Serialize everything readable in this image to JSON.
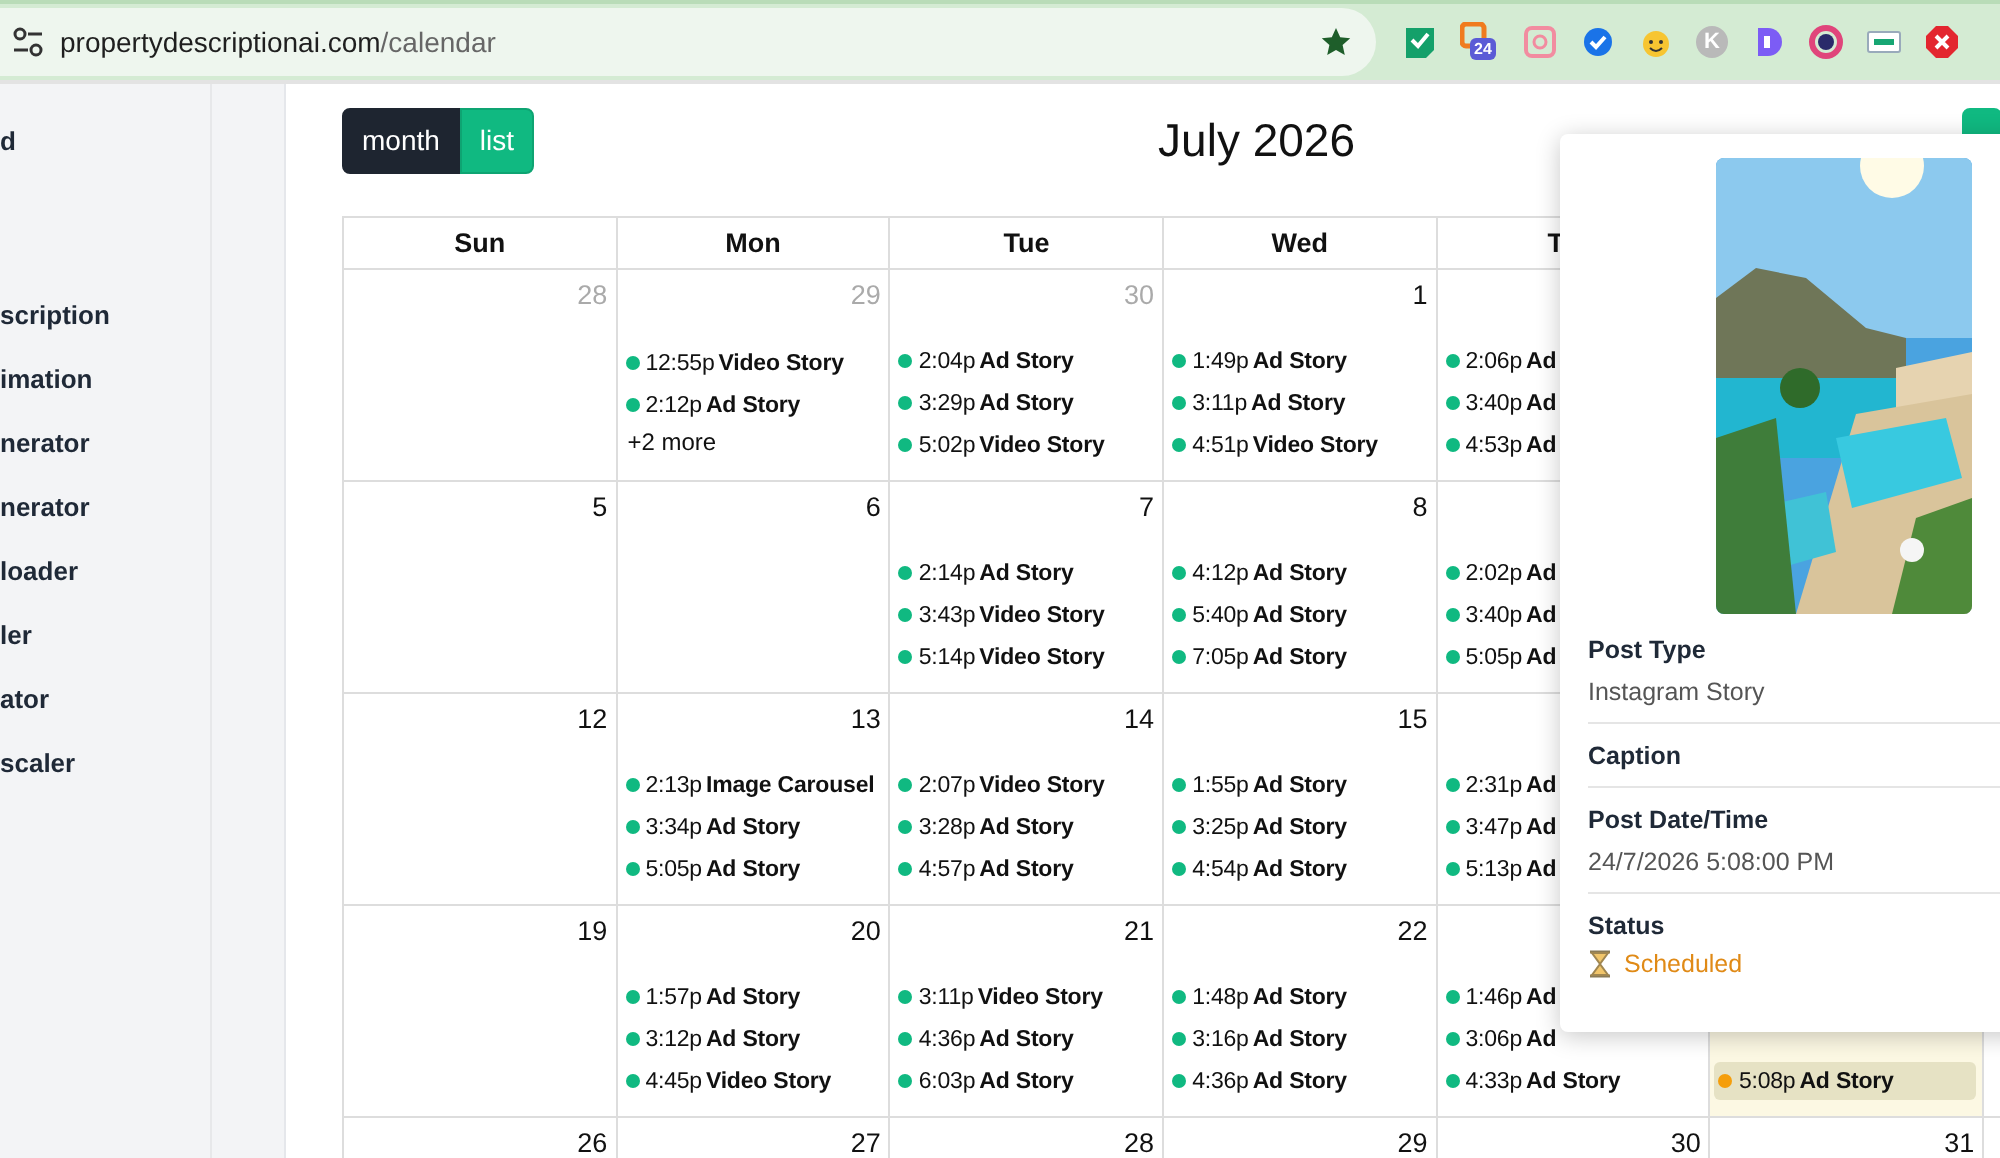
{
  "browser": {
    "url_host": "propertydescriptionai.com",
    "url_path": "/calendar",
    "extensions": [
      {
        "kind": "check"
      },
      {
        "kind": "calendar",
        "badge": "24"
      },
      {
        "kind": "square"
      },
      {
        "kind": "check-circle"
      },
      {
        "kind": "smiley"
      },
      {
        "kind": "letter",
        "letter": "K"
      },
      {
        "kind": "d"
      },
      {
        "kind": "ring"
      },
      {
        "kind": "card"
      },
      {
        "kind": "stop"
      }
    ]
  },
  "sidebar": {
    "items": [
      {
        "label": "d"
      },
      {
        "label": "scription"
      },
      {
        "label": "imation"
      },
      {
        "label": "nerator"
      },
      {
        "label": "nerator"
      },
      {
        "label": "loader"
      },
      {
        "label": "ler"
      },
      {
        "label": "ator"
      },
      {
        "label": "scaler"
      }
    ]
  },
  "toolbar": {
    "views": [
      {
        "label": "month",
        "selected": false
      },
      {
        "label": "list",
        "selected": true
      }
    ],
    "title": "July 2026"
  },
  "calendar": {
    "weekdays": [
      "Sun",
      "Mon",
      "Tue",
      "Wed",
      "T"
    ],
    "weeks": [
      {
        "days": [
          {
            "number": "28",
            "outside": true,
            "today": false
          },
          {
            "number": "29",
            "outside": true,
            "today": false,
            "events": [
              {
                "time": "12:55p",
                "title": "Video Story",
                "color": "#10b981",
                "selected": false
              },
              {
                "time": "2:12p",
                "title": "Ad Story",
                "color": "#10b981",
                "selected": false
              }
            ],
            "more": "+2 more"
          },
          {
            "number": "30",
            "outside": true,
            "today": false,
            "events": [
              {
                "time": "2:04p",
                "title": "Ad Story",
                "color": "#10b981",
                "selected": false
              },
              {
                "time": "3:29p",
                "title": "Ad Story",
                "color": "#10b981",
                "selected": false
              },
              {
                "time": "5:02p",
                "title": "Video Story",
                "color": "#10b981",
                "selected": false
              }
            ]
          },
          {
            "number": "1",
            "outside": false,
            "today": false,
            "events": [
              {
                "time": "1:49p",
                "title": "Ad Story",
                "color": "#10b981",
                "selected": false
              },
              {
                "time": "3:11p",
                "title": "Ad Story",
                "color": "#10b981",
                "selected": false
              },
              {
                "time": "4:51p",
                "title": "Video Story",
                "color": "#10b981",
                "selected": false
              }
            ]
          },
          {
            "today": false,
            "events": [
              {
                "time": "2:06p",
                "title": "Ad",
                "color": "#10b981",
                "selected": false
              },
              {
                "time": "3:40p",
                "title": "Ad",
                "color": "#10b981",
                "selected": false
              },
              {
                "time": "4:53p",
                "title": "Ad",
                "color": "#10b981",
                "selected": false
              }
            ]
          }
        ]
      },
      {
        "days": [
          {
            "number": "5",
            "outside": false,
            "today": false
          },
          {
            "number": "6",
            "outside": false,
            "today": false
          },
          {
            "number": "7",
            "outside": false,
            "today": false,
            "events": [
              {
                "time": "2:14p",
                "title": "Ad Story",
                "color": "#10b981",
                "selected": false
              },
              {
                "time": "3:43p",
                "title": "Video Story",
                "color": "#10b981",
                "selected": false
              },
              {
                "time": "5:14p",
                "title": "Video Story",
                "color": "#10b981",
                "selected": false
              }
            ]
          },
          {
            "number": "8",
            "outside": false,
            "today": false,
            "events": [
              {
                "time": "4:12p",
                "title": "Ad Story",
                "color": "#10b981",
                "selected": false
              },
              {
                "time": "5:40p",
                "title": "Ad Story",
                "color": "#10b981",
                "selected": false
              },
              {
                "time": "7:05p",
                "title": "Ad Story",
                "color": "#10b981",
                "selected": false
              }
            ]
          },
          {
            "today": false,
            "events": [
              {
                "time": "2:02p",
                "title": "Ad",
                "color": "#10b981",
                "selected": false
              },
              {
                "time": "3:40p",
                "title": "Ad",
                "color": "#10b981",
                "selected": false
              },
              {
                "time": "5:05p",
                "title": "Ad",
                "color": "#10b981",
                "selected": false
              }
            ]
          }
        ]
      },
      {
        "days": [
          {
            "number": "12",
            "outside": false,
            "today": false
          },
          {
            "number": "13",
            "outside": false,
            "today": false,
            "events": [
              {
                "time": "2:13p",
                "title": "Image Carousel",
                "color": "#10b981",
                "selected": false
              },
              {
                "time": "3:34p",
                "title": "Ad Story",
                "color": "#10b981",
                "selected": false
              },
              {
                "time": "5:05p",
                "title": "Ad Story",
                "color": "#10b981",
                "selected": false
              }
            ]
          },
          {
            "number": "14",
            "outside": false,
            "today": false,
            "events": [
              {
                "time": "2:07p",
                "title": "Video Story",
                "color": "#10b981",
                "selected": false
              },
              {
                "time": "3:28p",
                "title": "Ad Story",
                "color": "#10b981",
                "selected": false
              },
              {
                "time": "4:57p",
                "title": "Ad Story",
                "color": "#10b981",
                "selected": false
              }
            ]
          },
          {
            "number": "15",
            "outside": false,
            "today": false,
            "events": [
              {
                "time": "1:55p",
                "title": "Ad Story",
                "color": "#10b981",
                "selected": false
              },
              {
                "time": "3:25p",
                "title": "Ad Story",
                "color": "#10b981",
                "selected": false
              },
              {
                "time": "4:54p",
                "title": "Ad Story",
                "color": "#10b981",
                "selected": false
              }
            ]
          },
          {
            "today": false,
            "events": [
              {
                "time": "2:31p",
                "title": "Ad",
                "color": "#10b981",
                "selected": false
              },
              {
                "time": "3:47p",
                "title": "Ad",
                "color": "#10b981",
                "selected": false
              },
              {
                "time": "5:13p",
                "title": "Ad",
                "color": "#10b981",
                "selected": false
              }
            ]
          }
        ]
      },
      {
        "days": [
          {
            "number": "19",
            "outside": false,
            "today": false
          },
          {
            "number": "20",
            "outside": false,
            "today": false,
            "events": [
              {
                "time": "1:57p",
                "title": "Ad Story",
                "color": "#10b981",
                "selected": false
              },
              {
                "time": "3:12p",
                "title": "Ad Story",
                "color": "#10b981",
                "selected": false
              },
              {
                "time": "4:45p",
                "title": "Video Story",
                "color": "#10b981",
                "selected": false
              }
            ]
          },
          {
            "number": "21",
            "outside": false,
            "today": false,
            "events": [
              {
                "time": "3:11p",
                "title": "Video Story",
                "color": "#10b981",
                "selected": false
              },
              {
                "time": "4:36p",
                "title": "Ad Story",
                "color": "#10b981",
                "selected": false
              },
              {
                "time": "6:03p",
                "title": "Ad Story",
                "color": "#10b981",
                "selected": false
              }
            ]
          },
          {
            "number": "22",
            "outside": false,
            "today": false,
            "events": [
              {
                "time": "1:48p",
                "title": "Ad Story",
                "color": "#10b981",
                "selected": false
              },
              {
                "time": "3:16p",
                "title": "Ad Story",
                "color": "#10b981",
                "selected": false
              },
              {
                "time": "4:36p",
                "title": "Ad Story",
                "color": "#10b981",
                "selected": false
              }
            ]
          },
          {
            "today": false,
            "events": [
              {
                "time": "1:46p",
                "title": "Ad",
                "color": "#10b981",
                "selected": false
              },
              {
                "time": "3:06p",
                "title": "Ad",
                "color": "#10b981",
                "selected": false
              },
              {
                "time": "4:33p",
                "title": "Ad Story",
                "color": "#10b981",
                "selected": false
              }
            ]
          },
          {
            "today": true,
            "events": [
              {
                "time": "5:08p",
                "title": "Ad Story",
                "color": "#f59e0b",
                "selected": true
              }
            ]
          }
        ]
      },
      {
        "days": [
          {
            "number": "26",
            "outside": false,
            "today": false
          },
          {
            "number": "27",
            "outside": false,
            "today": false
          },
          {
            "number": "28",
            "outside": false,
            "today": false
          },
          {
            "number": "29",
            "outside": false,
            "today": false
          },
          {
            "number": "30",
            "outside": false,
            "today": false
          },
          {
            "number": "31",
            "outside": false,
            "today": false
          }
        ]
      }
    ]
  },
  "popover": {
    "fields": [
      {
        "kind": "text",
        "label": "Post Type",
        "value": "Instagram Story"
      },
      {
        "kind": "text",
        "label": "Caption"
      },
      {
        "kind": "text",
        "label": "Post Date/Time",
        "value": "24/7/2026 5:08:00 PM"
      },
      {
        "kind": "status",
        "label": "Status",
        "value": "Scheduled"
      }
    ]
  }
}
